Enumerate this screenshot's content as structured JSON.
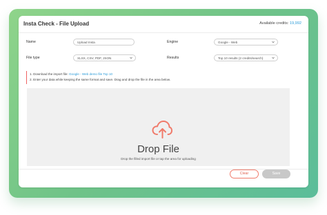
{
  "header": {
    "title": "Insta Check - File Upload",
    "credits_label": "Available credits:",
    "credits_value": "19,992"
  },
  "form": {
    "name_label": "Name",
    "name_value": "Upload Insta",
    "engine_label": "Engine",
    "engine_value": "Google - Web",
    "filetype_label": "File type",
    "filetype_value": "XLSX, CSV, PDF, JSON",
    "results_label": "Results",
    "results_value": "Top 10 results (2 credits/search)"
  },
  "notice": {
    "line1_prefix": "1. Download the import file:",
    "line1_link": "Google - Web demo file Top 10",
    "line2": "2. Enter your data while keeping the same format and save. Drag and drop the file in the area below."
  },
  "dropzone": {
    "icon": "cloud-upload-icon",
    "title": "Drop File",
    "subtitle": "Drop the filled import file or tap the area for uploading"
  },
  "footer": {
    "clear_label": "Clear",
    "save_label": "Save"
  },
  "colors": {
    "accent_blue": "#2a9bd8",
    "accent_coral": "#f07a6a",
    "frame_green": "#6fc388"
  }
}
